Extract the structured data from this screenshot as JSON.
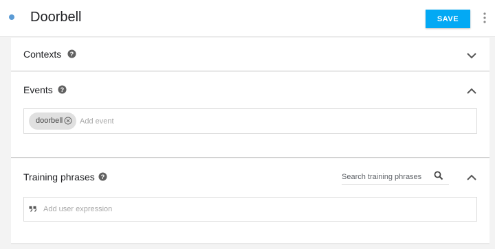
{
  "header": {
    "title": "Doorbell",
    "save_label": "SAVE",
    "status_dot_color": "#5b9bd5",
    "save_color": "#03a9f4"
  },
  "contexts": {
    "label": "Contexts",
    "help_icon": "help-circle-icon",
    "chevron": "chevron-down-icon"
  },
  "events": {
    "label": "Events",
    "help_icon": "help-circle-icon",
    "chevron": "chevron-up-icon",
    "chips": [
      {
        "label": "doorbell",
        "remove_icon": "remove-circle-icon"
      }
    ],
    "placeholder": "Add event"
  },
  "training_phrases": {
    "label": "Training phrases",
    "help_icon": "help-circle-icon",
    "chevron": "chevron-up-icon",
    "search_placeholder": "Search training phrases",
    "search_icon": "search-icon",
    "input_icon": "quote-icon",
    "placeholder": "Add user expression"
  }
}
